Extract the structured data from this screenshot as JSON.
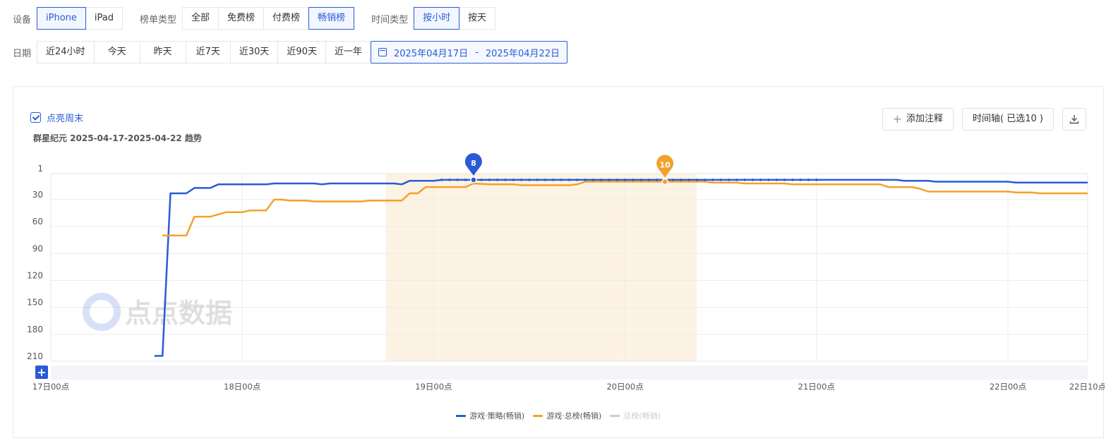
{
  "filters": {
    "device": {
      "label": "设备",
      "options": [
        "iPhone",
        "iPad"
      ],
      "active": 0
    },
    "list_type": {
      "label": "榜单类型",
      "options": [
        "全部",
        "免费榜",
        "付费榜",
        "畅销榜"
      ],
      "active": 3
    },
    "time_type": {
      "label": "时间类型",
      "options": [
        "按小时",
        "按天"
      ],
      "active": 0
    },
    "date": {
      "label": "日期",
      "options": [
        "近24小时",
        "今天",
        "昨天",
        "近7天",
        "近30天",
        "近90天",
        "近一年"
      ],
      "range_start": "2025年04月17日",
      "range_sep": "-",
      "range_end": "2025年04月22日"
    }
  },
  "panel": {
    "highlight_weekend_label": "点亮周末",
    "subtitle": "群星纪元 2025-04-17-2025-04-22 趋势",
    "add_note_label": "添加注释",
    "timeline_label": "时间轴( 已选10 )",
    "watermark": "点点数据",
    "zoom_button": "+"
  },
  "colors": {
    "accent": "#2a5bd7",
    "series_blue": "#2a5bd7",
    "series_orange": "#f3a12c",
    "series_gray": "#cccccc",
    "weekend_shade": "#fdf3e4"
  },
  "chart_data": {
    "type": "line",
    "title": "",
    "y_inverted": true,
    "ylim": [
      1,
      210
    ],
    "y_ticks": [
      "1",
      "30",
      "60",
      "90",
      "120",
      "150",
      "180",
      "210"
    ],
    "x_range": [
      "2025-04-17 00:00",
      "2025-04-22 10:00"
    ],
    "x_ticks": [
      "17日00点",
      "18日00点",
      "19日00点",
      "20日00点",
      "21日00点",
      "22日00点",
      "22日10点"
    ],
    "shaded_range": [
      "2025-04-18 18:00",
      "2025-04-20 09:00"
    ],
    "annotations": [
      {
        "series": "游戏·策略(畅销)",
        "x": "2025-04-19 05:00",
        "label": "8"
      },
      {
        "series": "游戏·总榜(畅销)",
        "x": "2025-04-20 05:00",
        "label": "10"
      }
    ],
    "series": [
      {
        "name": "游戏·策略(畅销)",
        "color": "#2a5bd7",
        "points": [
          [
            "2025-04-17 13:00",
            204
          ],
          [
            "2025-04-17 14:00",
            204
          ],
          [
            "2025-04-17 15:00",
            23
          ],
          [
            "2025-04-17 16:00",
            23
          ],
          [
            "2025-04-17 17:00",
            23
          ],
          [
            "2025-04-17 18:00",
            17
          ],
          [
            "2025-04-17 20:00",
            17
          ],
          [
            "2025-04-17 21:00",
            13
          ],
          [
            "2025-04-18 00:00",
            13
          ],
          [
            "2025-04-18 03:00",
            13
          ],
          [
            "2025-04-18 04:00",
            12
          ],
          [
            "2025-04-18 09:00",
            12
          ],
          [
            "2025-04-18 10:00",
            13
          ],
          [
            "2025-04-18 11:00",
            12
          ],
          [
            "2025-04-18 19:00",
            12
          ],
          [
            "2025-04-18 20:00",
            13
          ],
          [
            "2025-04-18 21:00",
            9
          ],
          [
            "2025-04-19 00:00",
            9
          ],
          [
            "2025-04-19 01:00",
            8
          ],
          [
            "2025-04-19 05:00",
            8
          ],
          [
            "2025-04-20 05:00",
            8
          ],
          [
            "2025-04-21 00:00",
            8
          ],
          [
            "2025-04-21 10:00",
            8
          ],
          [
            "2025-04-21 11:00",
            9
          ],
          [
            "2025-04-21 14:00",
            9
          ],
          [
            "2025-04-21 15:00",
            10
          ],
          [
            "2025-04-22 00:00",
            10
          ],
          [
            "2025-04-22 01:00",
            11
          ],
          [
            "2025-04-22 10:00",
            11
          ]
        ]
      },
      {
        "name": "游戏·总榜(畅销)",
        "color": "#f3a12c",
        "points": [
          [
            "2025-04-17 14:00",
            70
          ],
          [
            "2025-04-17 17:00",
            70
          ],
          [
            "2025-04-17 18:00",
            49
          ],
          [
            "2025-04-17 20:00",
            49
          ],
          [
            "2025-04-17 22:00",
            44
          ],
          [
            "2025-04-18 00:00",
            44
          ],
          [
            "2025-04-18 01:00",
            42
          ],
          [
            "2025-04-18 03:00",
            42
          ],
          [
            "2025-04-18 04:00",
            30
          ],
          [
            "2025-04-18 05:00",
            30
          ],
          [
            "2025-04-18 06:00",
            31
          ],
          [
            "2025-04-18 08:00",
            31
          ],
          [
            "2025-04-18 09:00",
            32
          ],
          [
            "2025-04-18 15:00",
            32
          ],
          [
            "2025-04-18 16:00",
            31
          ],
          [
            "2025-04-18 20:00",
            31
          ],
          [
            "2025-04-18 21:00",
            23
          ],
          [
            "2025-04-18 22:00",
            23
          ],
          [
            "2025-04-18 23:00",
            16
          ],
          [
            "2025-04-19 04:00",
            16
          ],
          [
            "2025-04-19 05:00",
            12
          ],
          [
            "2025-04-19 07:00",
            13
          ],
          [
            "2025-04-19 10:00",
            13
          ],
          [
            "2025-04-19 11:00",
            14
          ],
          [
            "2025-04-19 17:00",
            14
          ],
          [
            "2025-04-19 18:00",
            13
          ],
          [
            "2025-04-19 19:00",
            10
          ],
          [
            "2025-04-20 00:00",
            10
          ],
          [
            "2025-04-20 05:00",
            10
          ],
          [
            "2025-04-20 10:00",
            10
          ],
          [
            "2025-04-20 11:00",
            11
          ],
          [
            "2025-04-20 14:00",
            11
          ],
          [
            "2025-04-20 15:00",
            12
          ],
          [
            "2025-04-20 20:00",
            12
          ],
          [
            "2025-04-20 21:00",
            13
          ],
          [
            "2025-04-21 08:00",
            13
          ],
          [
            "2025-04-21 09:00",
            16
          ],
          [
            "2025-04-21 12:00",
            16
          ],
          [
            "2025-04-21 13:00",
            18
          ],
          [
            "2025-04-21 14:00",
            21
          ],
          [
            "2025-04-22 00:00",
            21
          ],
          [
            "2025-04-22 01:00",
            22
          ],
          [
            "2025-04-22 03:00",
            22
          ],
          [
            "2025-04-22 04:00",
            23
          ],
          [
            "2025-04-22 10:00",
            23
          ]
        ]
      },
      {
        "name": "总榜(畅销)",
        "color": "#cccccc",
        "hidden": true,
        "points": []
      }
    ]
  }
}
